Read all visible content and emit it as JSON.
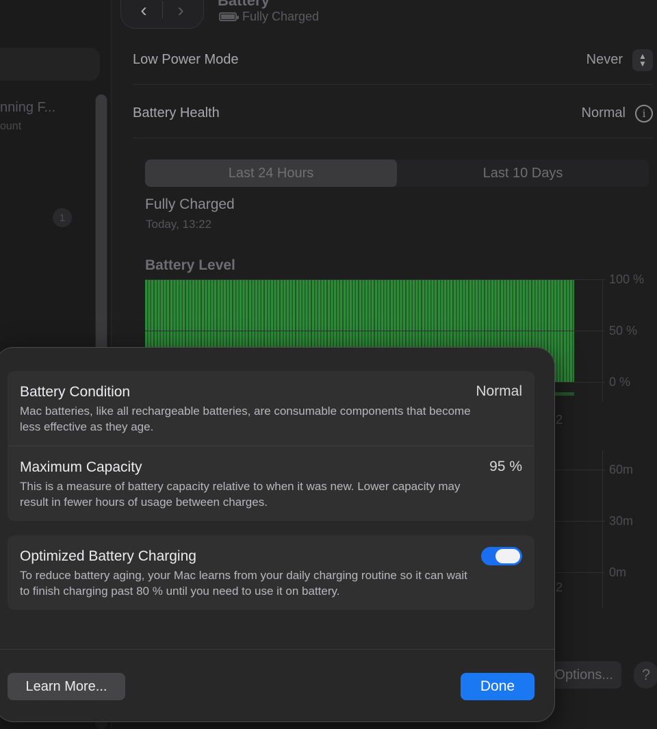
{
  "sidebar": {
    "user_name": "nning F...",
    "user_subtitle": "ount",
    "badge_count": "1"
  },
  "header": {
    "title": "Battery",
    "status": "Fully Charged",
    "back_icon": "chevron-left-icon",
    "forward_icon": "chevron-right-icon"
  },
  "settings": {
    "low_power_mode": {
      "label": "Low Power Mode",
      "value": "Never"
    },
    "battery_health": {
      "label": "Battery Health",
      "value": "Normal"
    }
  },
  "tabs": [
    {
      "label": "Last 24 Hours",
      "active": true
    },
    {
      "label": "Last 10 Days",
      "active": false
    }
  ],
  "charge_status": {
    "title": "Fully Charged",
    "time": "Today, 13:22"
  },
  "chart_data": {
    "type": "bar",
    "title": "Battery Level",
    "ylim": [
      0,
      100
    ],
    "y_ticks": [
      "100 %",
      "50 %",
      "0 %"
    ],
    "fill_level": 100,
    "secondary_y_ticks": [
      "60m",
      "30m",
      "0m"
    ],
    "bar_color": "#2f8a3a"
  },
  "peek_labels": {
    "axis_a": "2",
    "axis_b": "2"
  },
  "footer": {
    "options_label": "Options...",
    "help_label": "?"
  },
  "sheet": {
    "battery_condition": {
      "title": "Battery Condition",
      "value": "Normal",
      "description": "Mac batteries, like all rechargeable batteries, are consumable components that become less effective as they age."
    },
    "maximum_capacity": {
      "title": "Maximum Capacity",
      "value": "95 %",
      "description": "This is a measure of battery capacity relative to when it was new. Lower capacity may result in fewer hours of usage between charges."
    },
    "optimized_charging": {
      "title": "Optimized Battery Charging",
      "enabled": true,
      "description": "To reduce battery aging, your Mac learns from your daily charging routine so it can wait to finish charging past 80 % until you need to use it on battery."
    },
    "learn_more_label": "Learn More...",
    "done_label": "Done",
    "accent_color": "#1a78f2"
  }
}
